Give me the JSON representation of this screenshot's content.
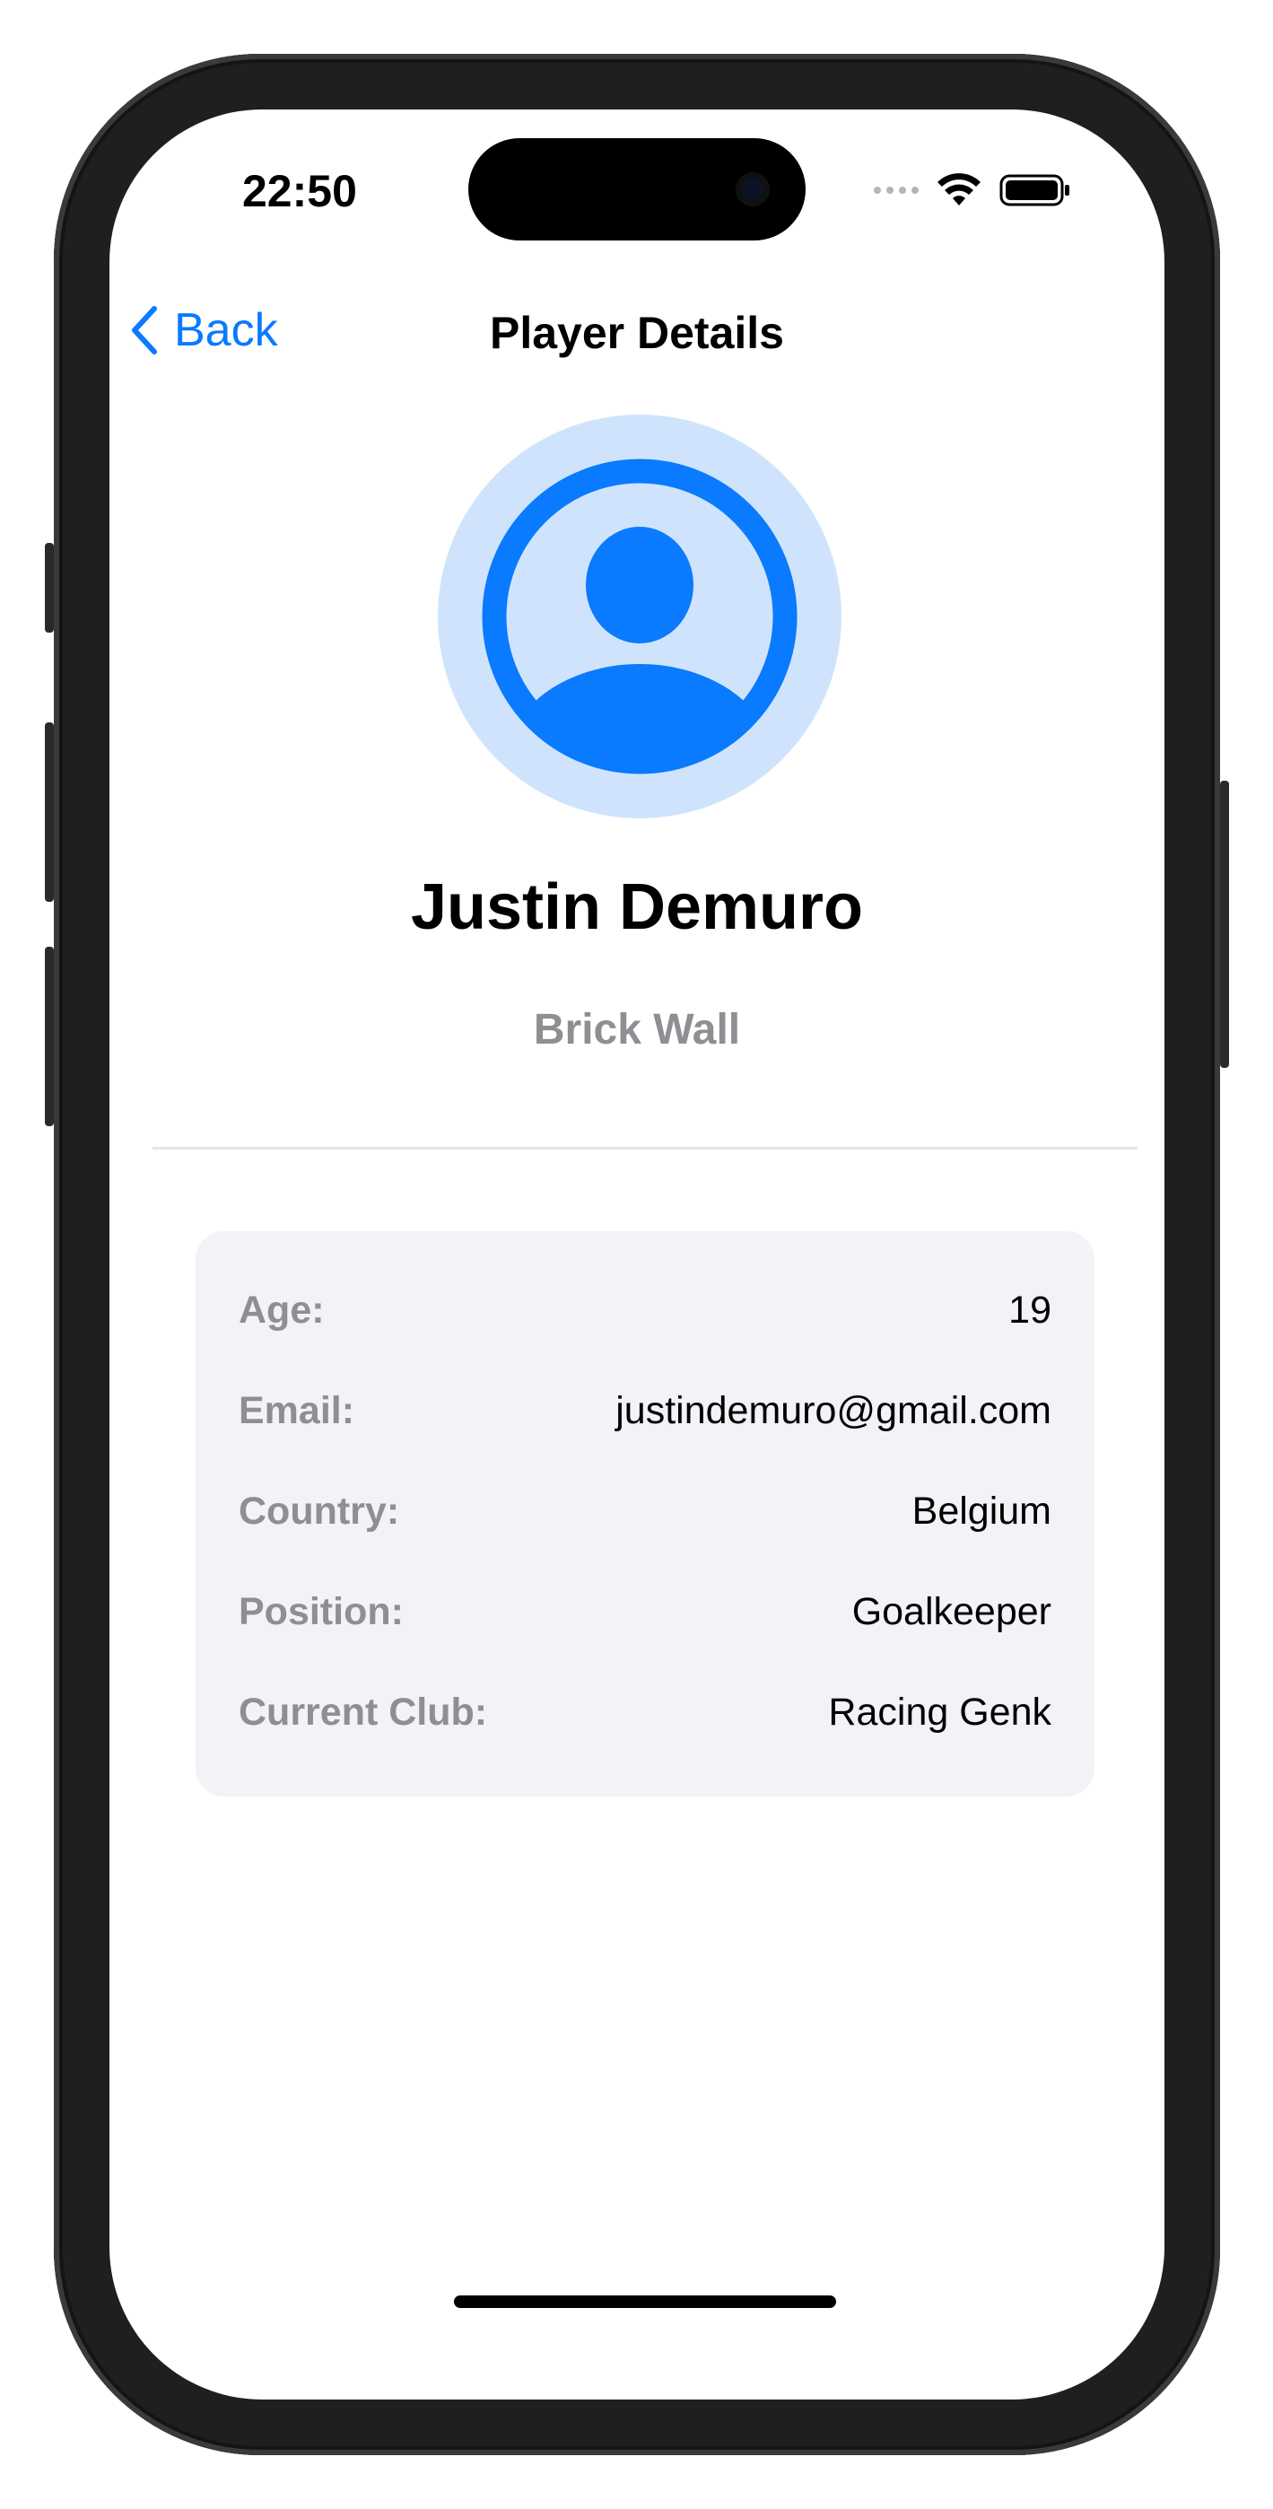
{
  "status_bar": {
    "time": "22:50",
    "signal_icon": "signal-dots-icon",
    "wifi_icon": "wifi-icon",
    "battery_icon": "battery-icon"
  },
  "nav": {
    "back_label": "Back",
    "back_icon": "chevron-left-icon",
    "title": "Player Details"
  },
  "profile": {
    "avatar_icon": "person-circle-icon",
    "name": "Justin Demuro",
    "nickname": "Brick Wall"
  },
  "details": [
    {
      "label": "Age:",
      "value": "19"
    },
    {
      "label": "Email:",
      "value": "justindemuro@gmail.com"
    },
    {
      "label": "Country:",
      "value": "Belgium"
    },
    {
      "label": "Position:",
      "value": "Goalkeeper"
    },
    {
      "label": "Current Club:",
      "value": "Racing Genk"
    }
  ],
  "colors": {
    "accent": "#0a7aff",
    "avatar_bg": "#cfe4fc",
    "secondary_text": "#8e8e93",
    "card_bg": "#f2f2f7"
  }
}
